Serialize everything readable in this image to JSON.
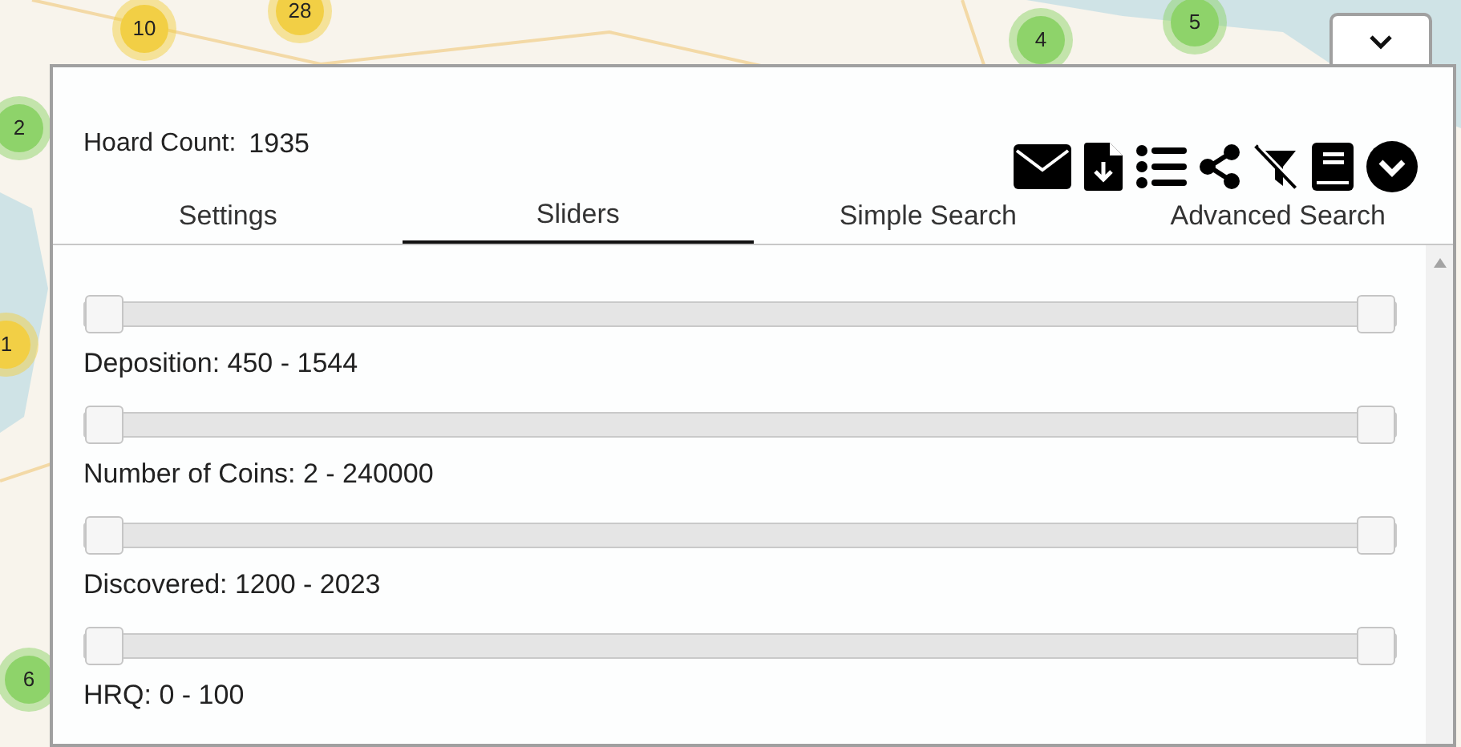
{
  "map_markers": [
    {
      "label": "10",
      "color": "#f2cf45"
    },
    {
      "label": "28",
      "color": "#f2cf45"
    },
    {
      "label": "2",
      "color": "#8ed36a"
    },
    {
      "label": "1",
      "color": "#f2cf45"
    },
    {
      "label": "6",
      "color": "#8ed36a"
    },
    {
      "label": "4",
      "color": "#8ed36a"
    },
    {
      "label": "5",
      "color": "#8ed36a"
    }
  ],
  "panel": {
    "hoard_count_label": "Hoard Count:",
    "hoard_count": "1935",
    "tabs": [
      {
        "label": "Settings",
        "selected": false
      },
      {
        "label": "Sliders",
        "selected": true
      },
      {
        "label": "Simple Search",
        "selected": false
      },
      {
        "label": "Advanced Search",
        "selected": false
      }
    ],
    "sliders": [
      {
        "label": "Deposition: 450 - 1544",
        "thumbs": [
          {
            "level": 0
          },
          {
            "level": 1
          }
        ]
      },
      {
        "label": "Number of Coins: 2 - 240000",
        "thumbs": [
          {
            "level": 0
          },
          {
            "level": 1
          }
        ]
      },
      {
        "label": "Discovered: 1200 - 2023",
        "thumbs": [
          {
            "level": 0
          },
          {
            "level": 1
          }
        ]
      },
      {
        "label": "HRQ: 0 - 100",
        "thumbs": [
          {
            "level": 0
          },
          {
            "level": 1
          }
        ]
      }
    ]
  }
}
